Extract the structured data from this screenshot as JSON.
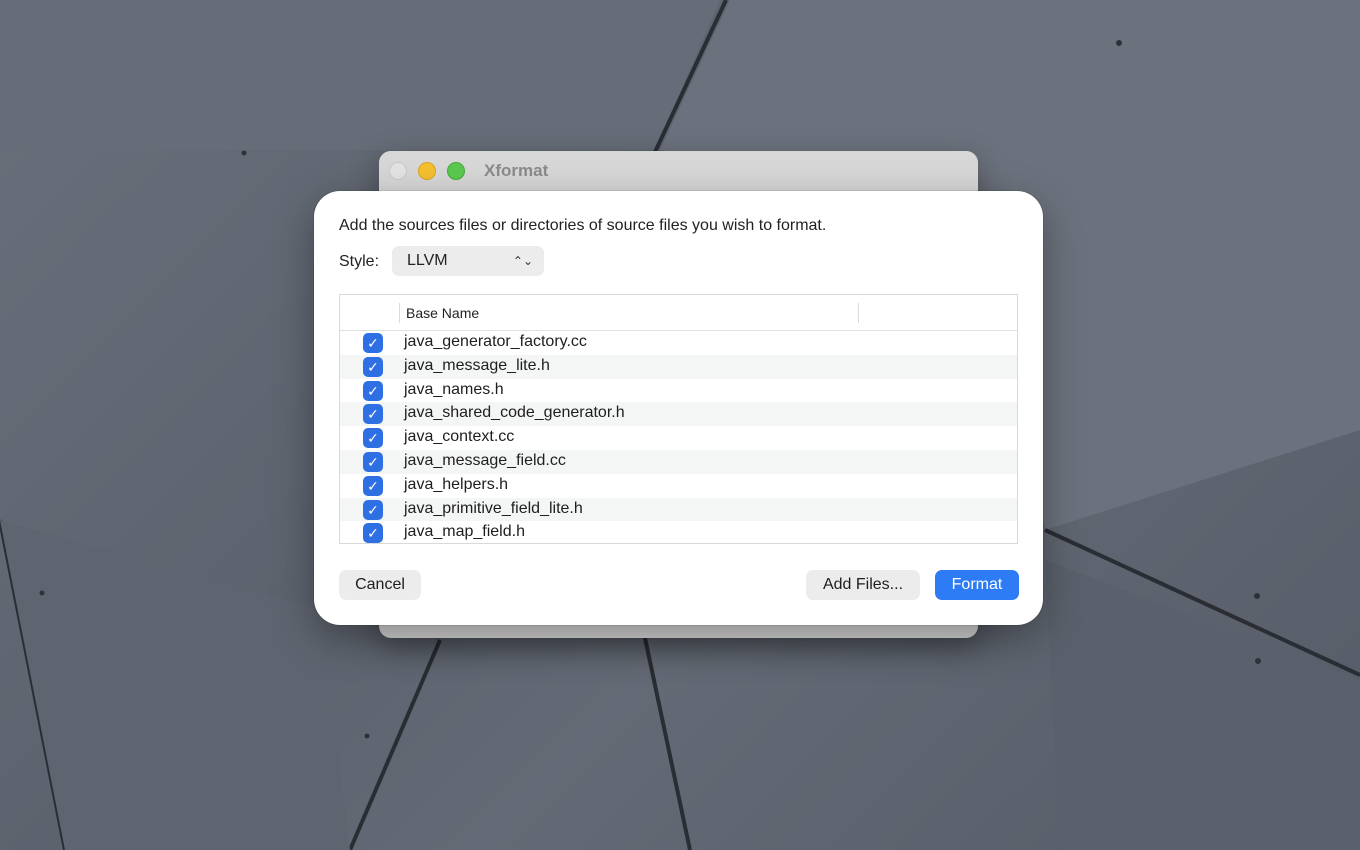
{
  "window": {
    "title": "Xformat"
  },
  "sheet": {
    "prompt": "Add the sources files or directories of source files you wish to format.",
    "style_label": "Style:",
    "style_value": "LLVM",
    "table": {
      "column_header": "Base Name",
      "rows": [
        {
          "name": "java_generator_factory.cc",
          "checked": true
        },
        {
          "name": "java_message_lite.h",
          "checked": true
        },
        {
          "name": "java_names.h",
          "checked": true
        },
        {
          "name": "java_shared_code_generator.h",
          "checked": true
        },
        {
          "name": "java_context.cc",
          "checked": true
        },
        {
          "name": "java_message_field.cc",
          "checked": true
        },
        {
          "name": "java_helpers.h",
          "checked": true
        },
        {
          "name": "java_primitive_field_lite.h",
          "checked": true
        },
        {
          "name": "java_map_field.h",
          "checked": true
        }
      ]
    },
    "buttons": {
      "cancel": "Cancel",
      "add_files": "Add Files...",
      "format": "Format"
    }
  },
  "colors": {
    "accent": "#2d7cf6",
    "checkbox": "#2f6fe4"
  }
}
